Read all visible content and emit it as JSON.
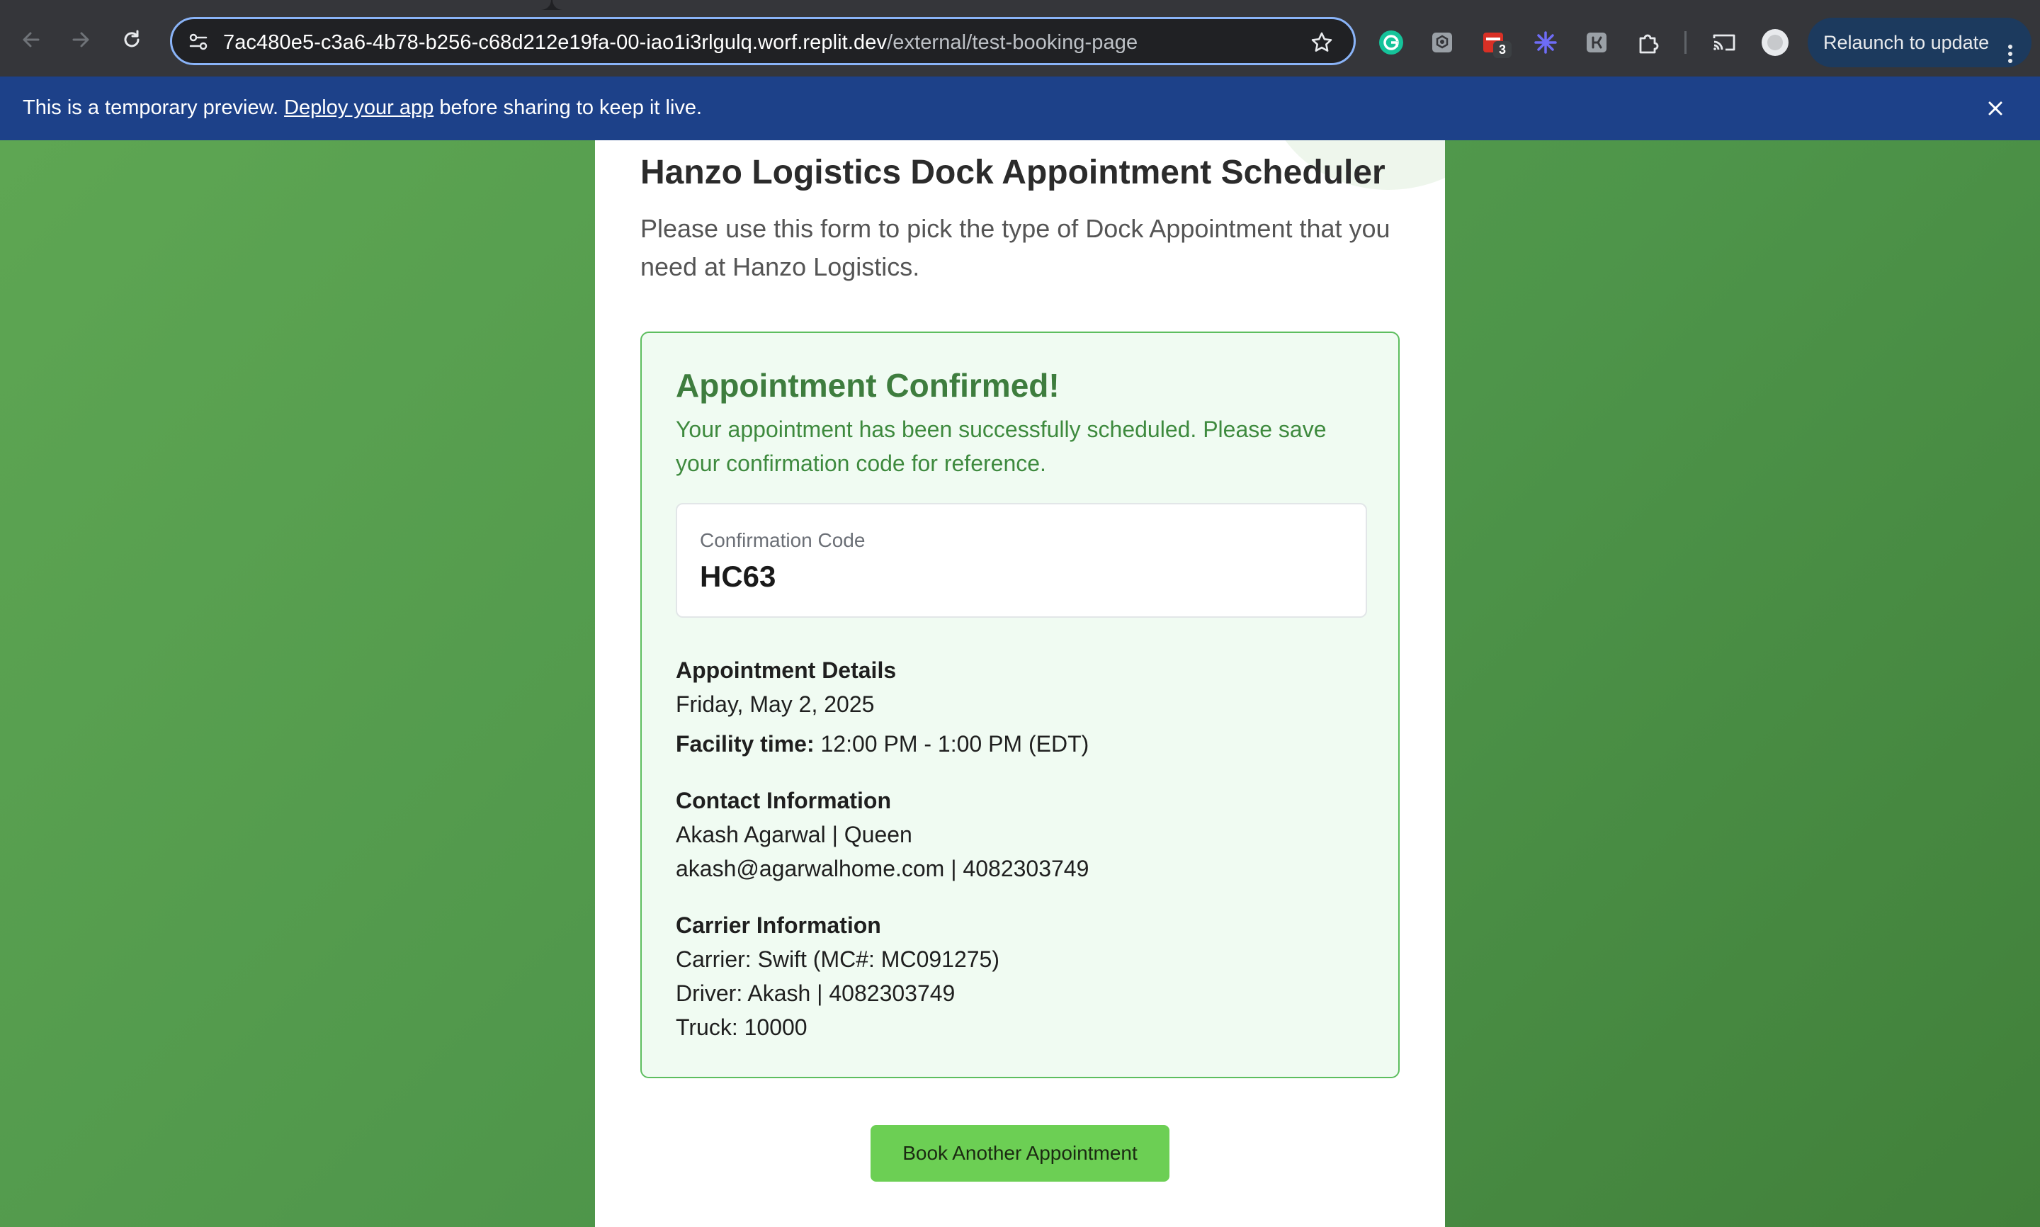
{
  "browser": {
    "url_host": "7ac480e5-c3a6-4b78-b256-c68d212e19fa-00-iao1i3rlgulq.worf.replit.dev",
    "url_path": "/external/test-booking-page",
    "extension_badge_count": "3",
    "relaunch_label": "Relaunch to update",
    "icons": [
      "back-arrow-icon",
      "forward-arrow-icon",
      "reload-icon",
      "site-settings-icon",
      "bookmark-star-icon",
      "grammarly-icon",
      "extension-icon",
      "extensions-puzzle-icon",
      "cast-icon",
      "profile-avatar-icon",
      "more-menu-icon"
    ],
    "accent": "#8ab4f8"
  },
  "banner": {
    "text_before": "This is a temporary preview. ",
    "link_text": "Deploy your app",
    "text_after": " before sharing to keep it live.",
    "background": "#1d4189"
  },
  "page": {
    "title": "Hanzo Logistics Dock Appointment Scheduler",
    "intro": "Please use this form to pick the type of Dock Appointment that you need at Hanzo Logistics.",
    "confirmation": {
      "heading": "Appointment Confirmed!",
      "message": "Your appointment has been successfully scheduled. Please save your confirmation code for reference.",
      "code_label": "Confirmation Code",
      "code_value": "HC63",
      "details_title": "Appointment Details",
      "details_date": "Friday, May 2, 2025",
      "facility_time_label": "Facility time:",
      "facility_time_value": " 12:00 PM - 1:00 PM (EDT)",
      "contact_title": "Contact Information",
      "contact_line1": "Akash Agarwal | Queen",
      "contact_line2": "akash@agarwalhome.com | 4082303749",
      "carrier_title": "Carrier Information",
      "carrier_line1": "Carrier: Swift (MC#: MC091275)",
      "carrier_line2": "Driver: Akash | 4082303749",
      "carrier_line3": "Truck: 10000"
    },
    "book_another_label": "Book Another Appointment",
    "colors": {
      "success_green": "#3e7d3e",
      "button_green": "#6ccf54",
      "background_green": "#4e954a"
    }
  }
}
